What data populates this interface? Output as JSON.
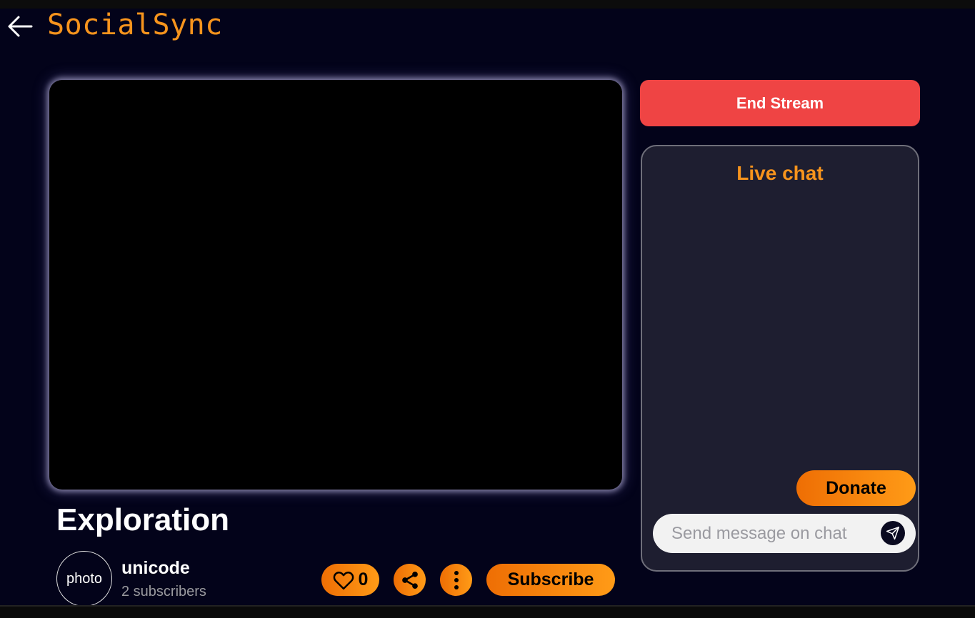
{
  "header": {
    "brand": "SocialSync",
    "back_icon": "arrow-left-icon"
  },
  "stream": {
    "title": "Exploration"
  },
  "channel": {
    "avatar_text": "photo",
    "name": "unicode",
    "subscribers": "2 subscribers"
  },
  "actions": {
    "like_count": "0",
    "like_icon": "heart-icon",
    "share_icon": "share-icon",
    "more_icon": "more-vertical-icon",
    "subscribe_label": "Subscribe"
  },
  "controls": {
    "end_stream_label": "End Stream"
  },
  "chat": {
    "title": "Live chat",
    "donate_label": "Donate",
    "input_value": "",
    "input_placeholder": "Send message on chat",
    "send_icon": "send-icon"
  },
  "colors": {
    "background": "#03031a",
    "accent": "#f7941d",
    "danger": "#ef4444",
    "chat_panel": "#1e1e30"
  }
}
